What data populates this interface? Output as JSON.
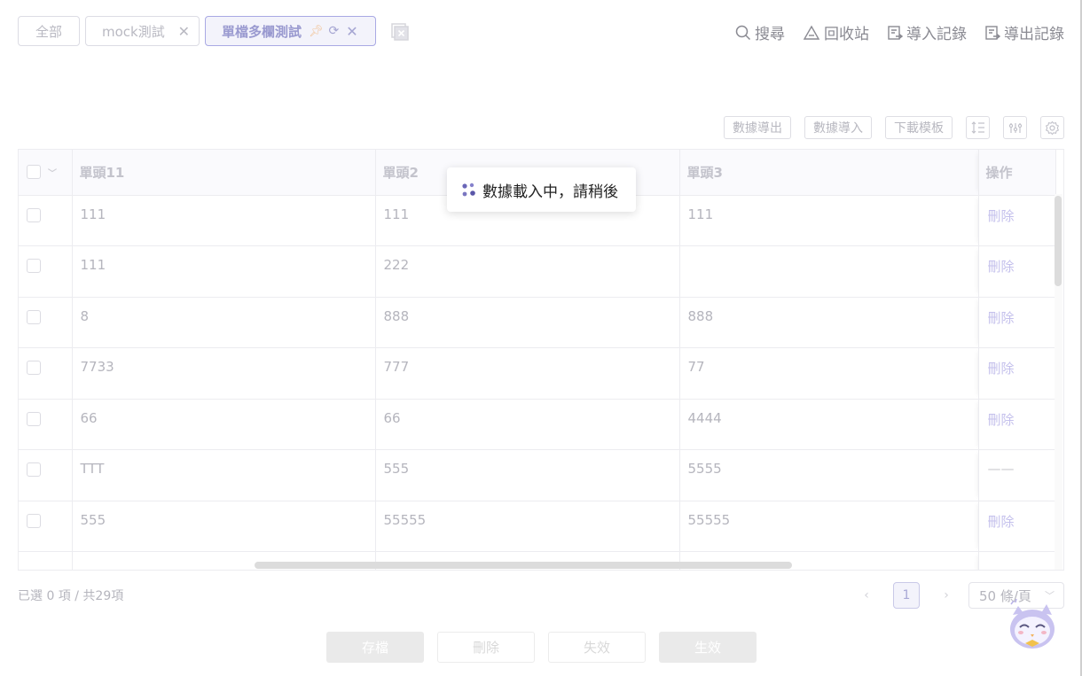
{
  "tabs": [
    {
      "label": "全部",
      "closable": false
    },
    {
      "label": "mock測試",
      "closable": true
    },
    {
      "label": "單檔多欄測試",
      "closable": true,
      "active": true
    }
  ],
  "top_actions": [
    {
      "label": "搜尋",
      "icon": "search-icon"
    },
    {
      "label": "回收站",
      "icon": "recycle-bin-icon"
    },
    {
      "label": "導入記錄",
      "icon": "import-record-icon"
    },
    {
      "label": "導出記錄",
      "icon": "export-record-icon"
    }
  ],
  "toolbar": {
    "export_label": "數據導出",
    "import_label": "數據導入",
    "template_label": "下載模板"
  },
  "table": {
    "headers": [
      "單頭11",
      "單頭2",
      "單頭3",
      "操作"
    ],
    "rows": [
      {
        "c1": "111",
        "c2": "111",
        "c3": "111",
        "op": "刪除"
      },
      {
        "c1": "111",
        "c2": "222",
        "c3": "",
        "op": "刪除"
      },
      {
        "c1": "8",
        "c2": "888",
        "c3": "888",
        "op": "刪除"
      },
      {
        "c1": "7733",
        "c2": "777",
        "c3": "77",
        "op": "刪除"
      },
      {
        "c1": "66",
        "c2": "66",
        "c3": "4444",
        "op": "刪除"
      },
      {
        "c1": "TTT",
        "c2": "555",
        "c3": "5555",
        "op": "——"
      },
      {
        "c1": "555",
        "c2": "55555",
        "c3": "55555",
        "op": "刪除"
      }
    ]
  },
  "loading": {
    "text": "數據載入中，請稍後"
  },
  "footer": {
    "summary": "已選 0 項 / 共29項",
    "current_page": "1",
    "page_size": "50 條/頁"
  },
  "bottom_buttons": {
    "save": "存檔",
    "delete": "刪除",
    "invalidate": "失效",
    "activate": "生效"
  }
}
